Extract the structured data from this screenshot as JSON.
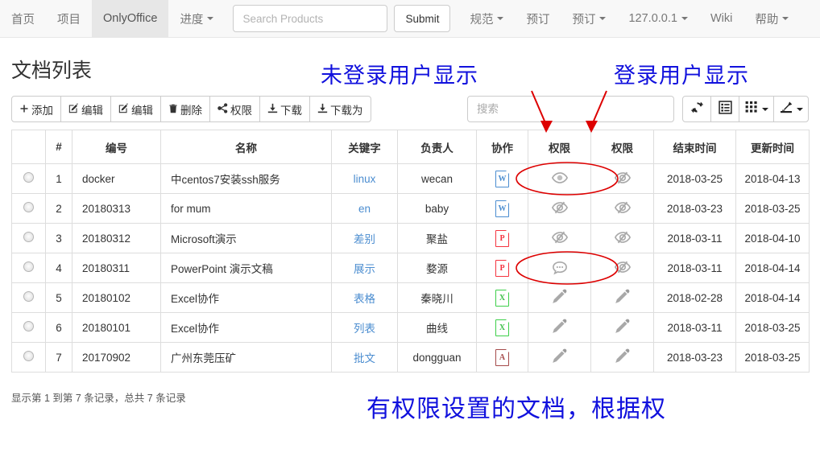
{
  "navbar": {
    "items": [
      {
        "label": "首页",
        "caret": false,
        "active": false,
        "name": "nav-item-home"
      },
      {
        "label": "项目",
        "caret": false,
        "active": false,
        "name": "nav-item-project"
      },
      {
        "label": "OnlyOffice",
        "caret": false,
        "active": true,
        "name": "nav-item-onlyoffice"
      },
      {
        "label": "进度",
        "caret": true,
        "active": false,
        "name": "nav-item-progress"
      }
    ],
    "search": {
      "placeholder": "Search Products",
      "value": ""
    },
    "submit_label": "Submit",
    "right_items": [
      {
        "label": "规范",
        "caret": true,
        "name": "nav-item-spec"
      },
      {
        "label": "预订",
        "caret": false,
        "name": "nav-item-booking"
      },
      {
        "label": "预订",
        "caret": true,
        "name": "nav-item-booking-menu"
      },
      {
        "label": "127.0.0.1",
        "caret": true,
        "name": "nav-item-host"
      },
      {
        "label": "Wiki",
        "caret": false,
        "name": "nav-item-wiki"
      },
      {
        "label": "帮助",
        "caret": true,
        "name": "nav-item-help"
      }
    ]
  },
  "page_title": "文档列表",
  "toolbar": {
    "buttons": [
      {
        "label": "添加",
        "icon": "plus-icon",
        "name": "add-button"
      },
      {
        "label": "编辑",
        "icon": "edit-icon",
        "name": "edit-button"
      },
      {
        "label": "编辑",
        "icon": "edit-icon",
        "name": "edit-alt-button"
      },
      {
        "label": "删除",
        "icon": "trash-icon",
        "name": "delete-button"
      },
      {
        "label": "权限",
        "icon": "share-icon",
        "name": "permission-button"
      },
      {
        "label": "下载",
        "icon": "download-icon",
        "name": "download-button"
      },
      {
        "label": "下载为",
        "icon": "download-icon",
        "name": "download-as-button"
      }
    ],
    "search_placeholder": "搜索",
    "search_value": "",
    "right_icons": [
      {
        "icon": "refresh-icon",
        "caret": false,
        "name": "refresh-button"
      },
      {
        "icon": "list-detail-icon",
        "caret": false,
        "name": "toggle-view-button"
      },
      {
        "icon": "columns-grid-icon",
        "caret": true,
        "name": "columns-button"
      },
      {
        "icon": "export-icon",
        "caret": true,
        "name": "export-button"
      }
    ]
  },
  "table": {
    "columns": [
      {
        "label": "",
        "name": "col-select"
      },
      {
        "label": "#",
        "name": "col-index"
      },
      {
        "label": "编号",
        "name": "col-number"
      },
      {
        "label": "名称",
        "name": "col-name"
      },
      {
        "label": "关键字",
        "name": "col-keyword"
      },
      {
        "label": "负责人",
        "name": "col-owner"
      },
      {
        "label": "协作",
        "name": "col-collaborate"
      },
      {
        "label": "权限",
        "name": "col-permission-guest"
      },
      {
        "label": "权限",
        "name": "col-permission-user"
      },
      {
        "label": "结束时间",
        "name": "col-end-time"
      },
      {
        "label": "更新时间",
        "name": "col-update-time"
      }
    ],
    "rows": [
      {
        "index": "1",
        "number": "docker",
        "name": "中centos7安装ssh服务",
        "keyword": "linux",
        "owner": "wecan",
        "filetype": "w",
        "fileletter": "W",
        "perm_guest": "eye",
        "perm_user": "eye-slash",
        "end_time": "2018-03-25",
        "update_time": "2018-04-13"
      },
      {
        "index": "2",
        "number": "20180313",
        "name": "for mum",
        "keyword": "en",
        "owner": "baby",
        "filetype": "w",
        "fileletter": "W",
        "perm_guest": "eye-slash",
        "perm_user": "eye-slash",
        "end_time": "2018-03-23",
        "update_time": "2018-03-25"
      },
      {
        "index": "3",
        "number": "20180312",
        "name": "Microsoft演示",
        "keyword": "差别",
        "owner": "聚盐",
        "filetype": "p",
        "fileletter": "P",
        "perm_guest": "eye-slash",
        "perm_user": "eye-slash",
        "end_time": "2018-03-11",
        "update_time": "2018-04-10"
      },
      {
        "index": "4",
        "number": "20180311",
        "name": "PowerPoint 演示文稿",
        "keyword": "展示",
        "owner": "婺源",
        "filetype": "p",
        "fileletter": "P",
        "perm_guest": "comment",
        "perm_user": "eye-slash",
        "end_time": "2018-03-11",
        "update_time": "2018-04-14"
      },
      {
        "index": "5",
        "number": "20180102",
        "name": "Excel协作",
        "keyword": "表格",
        "owner": "秦晓川",
        "filetype": "x",
        "fileletter": "X",
        "perm_guest": "pencil",
        "perm_user": "pencil",
        "end_time": "2018-02-28",
        "update_time": "2018-04-14"
      },
      {
        "index": "6",
        "number": "20180101",
        "name": "Excel协作",
        "keyword": "列表",
        "owner": "曲线",
        "filetype": "x",
        "fileletter": "X",
        "perm_guest": "pencil",
        "perm_user": "pencil",
        "end_time": "2018-03-11",
        "update_time": "2018-03-25"
      },
      {
        "index": "7",
        "number": "20170902",
        "name": "广州东莞压矿",
        "keyword": "批文",
        "owner": "dongguan",
        "filetype": "a",
        "fileletter": "A",
        "perm_guest": "pencil",
        "perm_user": "pencil",
        "end_time": "2018-03-23",
        "update_time": "2018-03-25"
      }
    ],
    "footer_info": "显示第 1 到第 7 条记录，总共 7 条记录"
  },
  "annotations": {
    "guest_note": "未登录用户显示",
    "user_note": "登录用户显示",
    "bottom_note": "有权限设置的文档，根据权",
    "color": "#1111dd",
    "marker_color": "#dd0000"
  }
}
